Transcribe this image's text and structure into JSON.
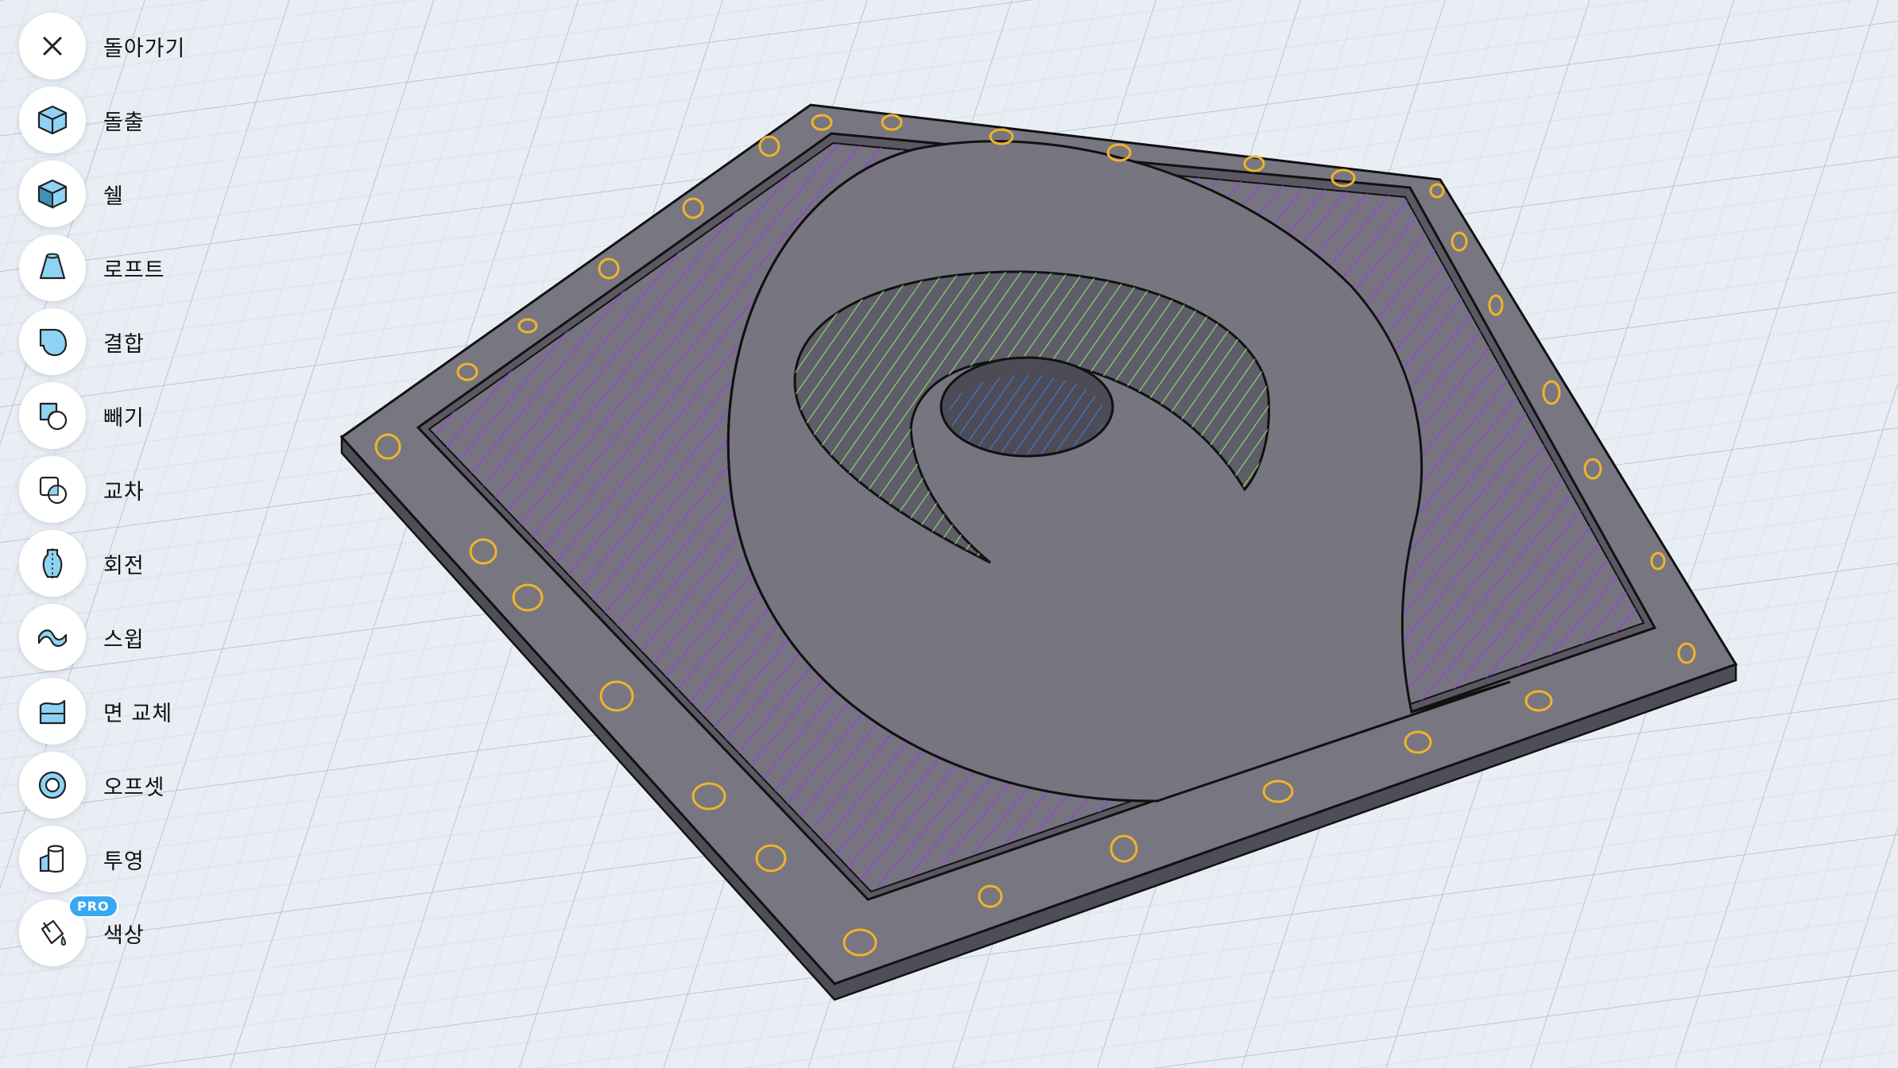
{
  "toolbar": {
    "items": [
      {
        "label": "돌아가기",
        "icon": "close-icon"
      },
      {
        "label": "돌출",
        "icon": "extrude-cube-icon"
      },
      {
        "label": "쉘",
        "icon": "shell-cube-icon"
      },
      {
        "label": "로프트",
        "icon": "loft-icon"
      },
      {
        "label": "결합",
        "icon": "union-icon"
      },
      {
        "label": "빼기",
        "icon": "subtract-icon"
      },
      {
        "label": "교차",
        "icon": "intersect-icon"
      },
      {
        "label": "회전",
        "icon": "revolve-icon"
      },
      {
        "label": "스윕",
        "icon": "sweep-icon"
      },
      {
        "label": "면 교체",
        "icon": "replace-face-icon"
      },
      {
        "label": "오프셋",
        "icon": "offset-icon"
      },
      {
        "label": "투영",
        "icon": "project-icon"
      },
      {
        "label": "색상",
        "icon": "paint-bucket-icon",
        "badge": "PRO"
      }
    ]
  },
  "colors": {
    "background": "#e9eef5",
    "grid": "#c9d3df",
    "body": "#767480",
    "body_side": "#5e5c66",
    "hatch_purple": "#9b3ee0",
    "hatch_green": "#7fcf6a",
    "hatch_blue": "#3c7fd0",
    "dot_outline": "#f0b429",
    "icon_fill": "#8fd3f4",
    "accent": "#3aa7f2"
  }
}
